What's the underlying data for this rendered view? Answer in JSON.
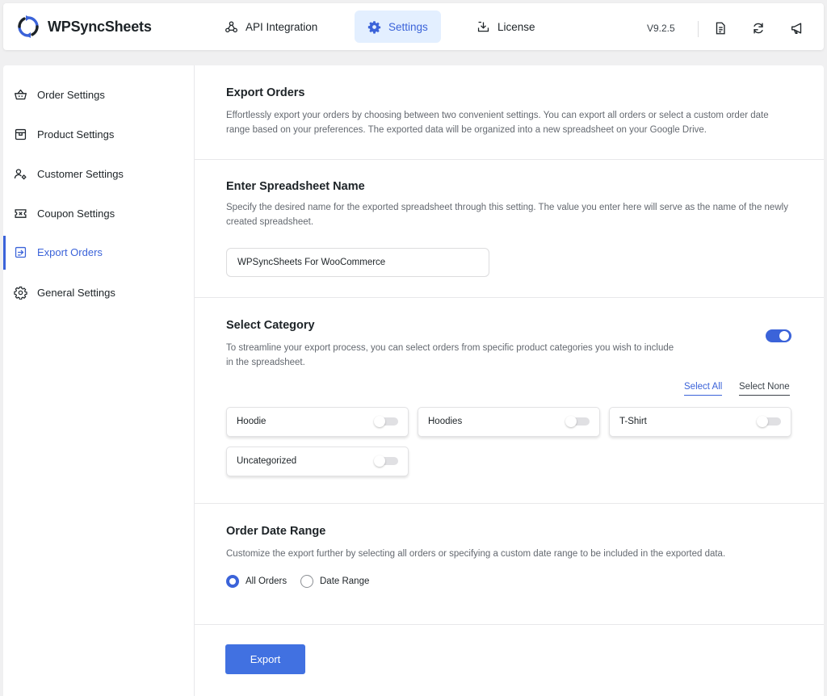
{
  "app": {
    "title": "WPSyncSheets",
    "version": "V9.2.5"
  },
  "nav": {
    "tabs": [
      {
        "label": "API Integration",
        "icon": "webhook-icon"
      },
      {
        "label": "Settings",
        "icon": "gear-icon",
        "active": true
      },
      {
        "label": "License",
        "icon": "download-tray-icon"
      }
    ]
  },
  "header_icons": [
    "document-icon",
    "refresh-icon",
    "megaphone-icon"
  ],
  "sidebar": {
    "items": [
      {
        "label": "Order Settings",
        "icon": "basket-icon"
      },
      {
        "label": "Product Settings",
        "icon": "store-icon"
      },
      {
        "label": "Customer Settings",
        "icon": "user-gear-icon"
      },
      {
        "label": "Coupon Settings",
        "icon": "ticket-icon"
      },
      {
        "label": "Export Orders",
        "icon": "export-icon",
        "active": true
      },
      {
        "label": "General Settings",
        "icon": "gear-icon"
      }
    ]
  },
  "export_orders": {
    "title": "Export Orders",
    "description": "Effortlessly export your orders by choosing between two convenient settings. You can export all orders or select a custom order date range based on your preferences. The exported data will be organized into a new spreadsheet on your Google Drive."
  },
  "spreadsheet_name": {
    "title": "Enter Spreadsheet Name",
    "description": "Specify the desired name for the exported spreadsheet through this setting. The value you enter here will serve as the name of the newly created spreadsheet.",
    "value": "WPSyncSheets For WooCommerce"
  },
  "select_category": {
    "title": "Select Category",
    "description": "To streamline your export process, you can select orders from specific product categories you wish to include in the spreadsheet.",
    "enabled": true,
    "select_all_label": "Select All",
    "select_none_label": "Select None",
    "categories": [
      {
        "label": "Hoodie",
        "checked": false
      },
      {
        "label": "Hoodies",
        "checked": false
      },
      {
        "label": "T-Shirt",
        "checked": false
      },
      {
        "label": "Uncategorized",
        "checked": false
      }
    ]
  },
  "date_range": {
    "title": "Order Date Range",
    "description": "Customize the export further by selecting all orders or specifying a custom date range to be included in the exported data.",
    "options": [
      {
        "label": "All Orders",
        "checked": true
      },
      {
        "label": "Date Range",
        "checked": false
      }
    ]
  },
  "export_button": {
    "label": "Export"
  },
  "colors": {
    "accent": "#3b63d9",
    "button": "#4171e1",
    "active_tab_bg": "#e3efff"
  }
}
